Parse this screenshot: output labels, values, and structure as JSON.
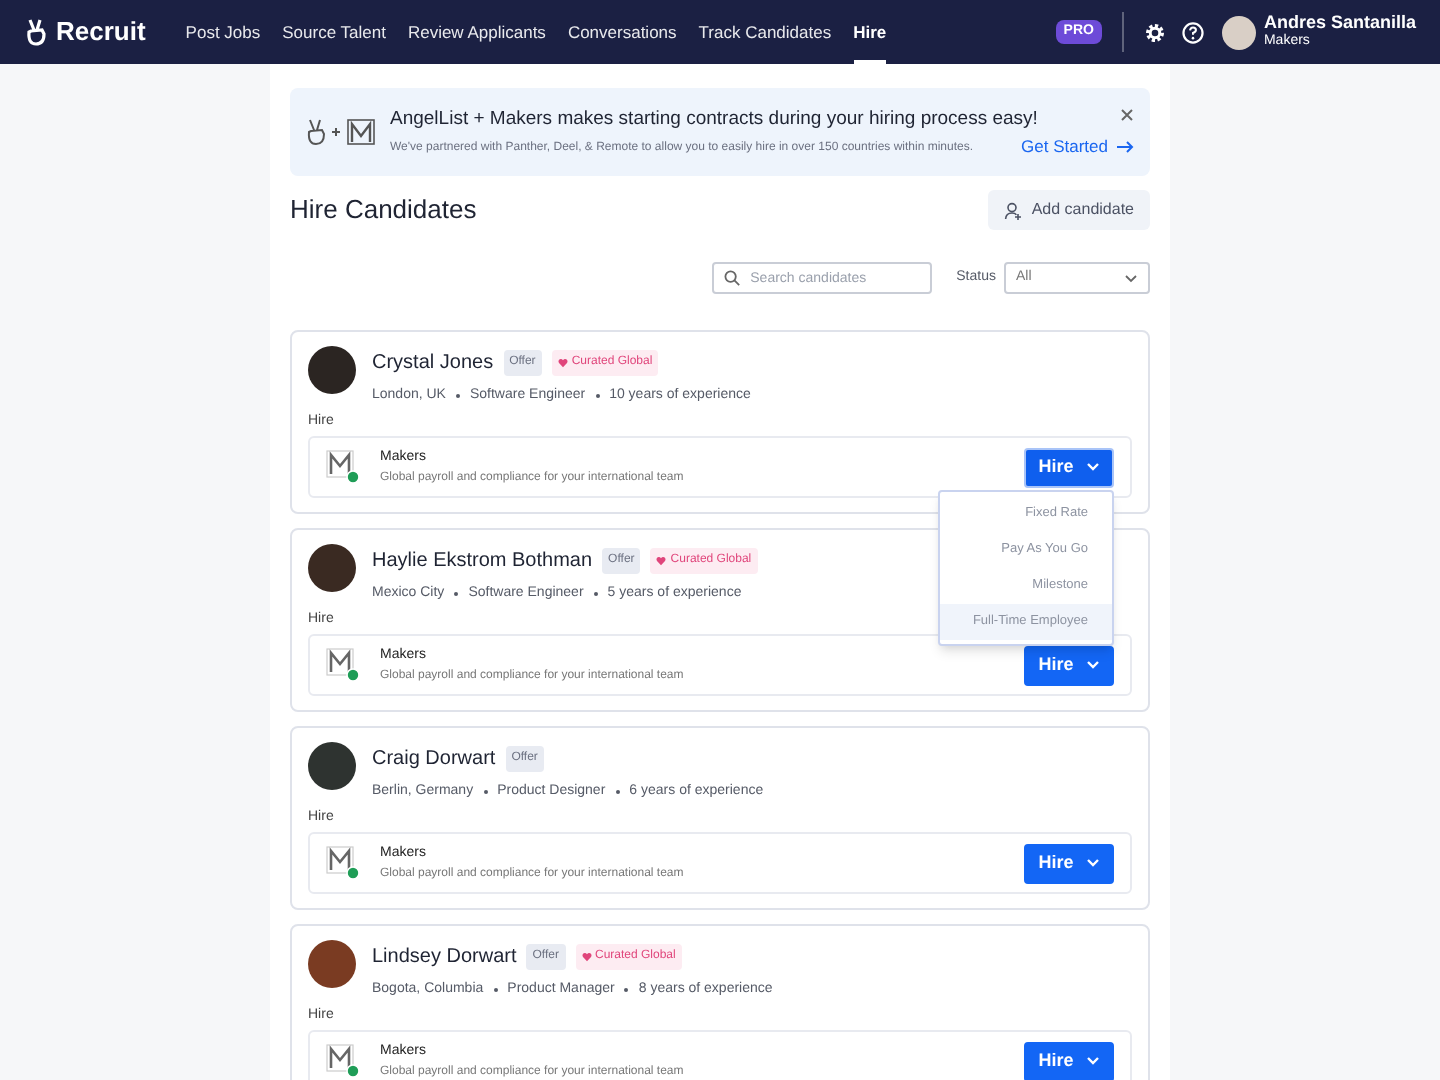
{
  "nav": {
    "brand": "Recruit",
    "items": [
      {
        "label": "Post Jobs",
        "selected": false
      },
      {
        "label": "Source Talent",
        "selected": false
      },
      {
        "label": "Review Applicants",
        "selected": false
      },
      {
        "label": "Conversations",
        "selected": false
      },
      {
        "label": "Track Candidates",
        "selected": false
      },
      {
        "label": "Hire",
        "selected": true
      }
    ],
    "pro_badge": "PRO",
    "user": {
      "name": "Andres Santanilla",
      "company": "Makers"
    }
  },
  "banner": {
    "title": "AngelList + Makers makes starting contracts during your hiring process easy!",
    "text": "We've partnered with Panther, Deel, & Remote to allow you to easily hire in over 150 countries within minutes.",
    "link": "Get Started"
  },
  "page_title": "Hire Candidates",
  "add_button": "Add candidate",
  "search": {
    "placeholder": "Search candidates"
  },
  "status": {
    "label": "Status",
    "value": "All"
  },
  "candidates": [
    {
      "name": "Crystal Jones",
      "tags": [
        {
          "kind": "offer",
          "label": "Offer"
        },
        {
          "kind": "curated",
          "label": "Curated Global"
        }
      ],
      "location": "London, UK",
      "role": "Software Engineer",
      "experience": "10 years of experience",
      "section": "Hire",
      "provider": "Makers",
      "provider_text": "Global payroll and compliance for your international team",
      "button": "Hire",
      "expanded": true
    },
    {
      "name": "Haylie Ekstrom Bothman",
      "tags": [
        {
          "kind": "offer",
          "label": "Offer"
        },
        {
          "kind": "curated",
          "label": "Curated Global"
        }
      ],
      "location": "Mexico City",
      "role": "Software Engineer",
      "experience": "5 years of experience",
      "section": "Hire",
      "provider": "Makers",
      "provider_text": "Global payroll and compliance for your international team",
      "button": "Hire",
      "expanded": false
    },
    {
      "name": "Craig Dorwart",
      "tags": [
        {
          "kind": "offer",
          "label": "Offer"
        }
      ],
      "location": "Berlin, Germany",
      "role": "Product Designer",
      "experience": "6 years of experience",
      "section": "Hire",
      "provider": "Makers",
      "provider_text": "Global payroll and compliance for your international team",
      "button": "Hire",
      "expanded": false
    },
    {
      "name": "Lindsey Dorwart",
      "tags": [
        {
          "kind": "offer",
          "label": "Offer"
        },
        {
          "kind": "curated",
          "label": "Curated Global"
        }
      ],
      "location": "Bogota, Columbia",
      "role": "Product Manager",
      "experience": "8 years of experience",
      "section": "Hire",
      "provider": "Makers",
      "provider_text": "Global payroll and compliance for your international team",
      "button": "Hire",
      "expanded": false
    }
  ],
  "hire_menu": [
    {
      "label": "Fixed Rate",
      "selected": false
    },
    {
      "label": "Pay As You Go",
      "selected": false
    },
    {
      "label": "Milestone",
      "selected": false
    },
    {
      "label": "Full-Time Employee",
      "selected": true
    }
  ]
}
